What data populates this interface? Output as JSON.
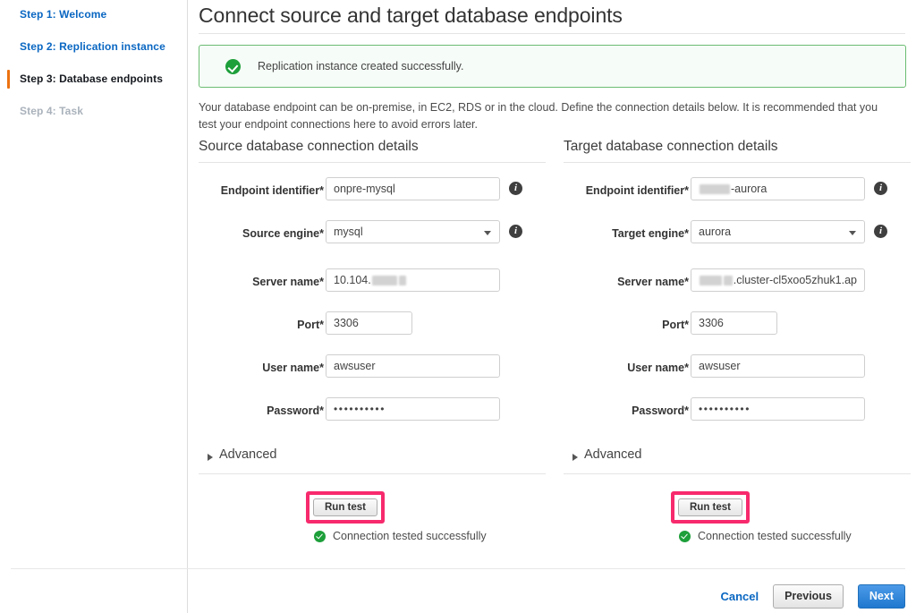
{
  "sidebar": {
    "steps": [
      {
        "label": "Step 1: Welcome",
        "state": "link"
      },
      {
        "label": "Step 2: Replication instance",
        "state": "link"
      },
      {
        "label": "Step 3: Database endpoints",
        "state": "active"
      },
      {
        "label": "Step 4: Task",
        "state": "muted"
      }
    ]
  },
  "header": {
    "title": "Connect source and target database endpoints"
  },
  "flash": {
    "icon": "success-check-icon",
    "message": "Replication instance created successfully."
  },
  "intro": {
    "text": "Your database endpoint can be on-premise, in EC2, RDS or in the cloud. Define the connection details below. It is recommended that you test your endpoint connections here to avoid errors later."
  },
  "source": {
    "heading": "Source database connection details",
    "fields": {
      "endpoint_identifier": {
        "label": "Endpoint identifier*",
        "value": "onpre-mysql",
        "info": "info-icon"
      },
      "engine": {
        "label": "Source engine*",
        "value": "mysql",
        "info": "info-icon"
      },
      "server_name": {
        "label": "Server name*",
        "value": "10.104.",
        "redacted": true
      },
      "port": {
        "label": "Port*",
        "value": "3306"
      },
      "user_name": {
        "label": "User name*",
        "value": "awsuser"
      },
      "password": {
        "label": "Password*",
        "value": "••••••••••"
      }
    },
    "advanced_label": "Advanced",
    "run_test_label": "Run test",
    "test_result": "Connection tested successfully"
  },
  "target": {
    "heading": "Target database connection details",
    "fields": {
      "endpoint_identifier": {
        "label": "Endpoint identifier*",
        "value": "-aurora",
        "redacted": true
      },
      "engine": {
        "label": "Target engine*",
        "value": "aurora",
        "info": "info-icon"
      },
      "server_name": {
        "label": "Server name*",
        "value": ".cluster-cl5xoo5zhuk1.ap",
        "redacted": true
      },
      "port": {
        "label": "Port*",
        "value": "3306"
      },
      "user_name": {
        "label": "User name*",
        "value": "awsuser"
      },
      "password": {
        "label": "Password*",
        "value": "••••••••••"
      }
    },
    "advanced_label": "Advanced",
    "run_test_label": "Run test",
    "test_result": "Connection tested successfully"
  },
  "footer": {
    "cancel_label": "Cancel",
    "previous_label": "Previous",
    "next_label": "Next"
  },
  "colors": {
    "link_blue": "#0a67c2",
    "active_orange": "#ec7211",
    "success_green": "#1d9f3a",
    "highlight_pink": "#f72a6d",
    "primary_blue": "#1f78cf"
  }
}
